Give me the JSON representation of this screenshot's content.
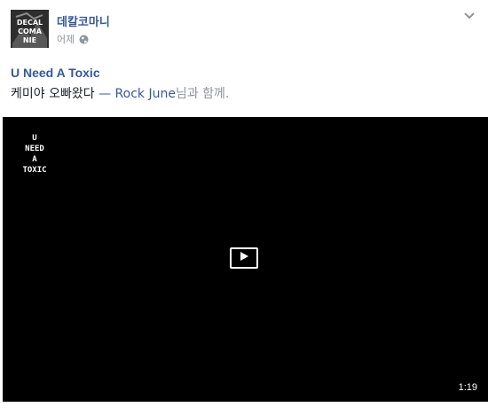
{
  "post": {
    "author": "데칼코마니",
    "timestamp": "어제",
    "privacy_icon": "globe-icon",
    "options_icon": "chevron-down-icon",
    "title": "U Need A Toxic",
    "caption": {
      "text": "케미야 오빠왔다",
      "separator": " — ",
      "tagged": "Rock June",
      "suffix": "님과 함께."
    },
    "avatar_text": "DECAL COMANIE",
    "video": {
      "overlay_lines": [
        "U",
        "NEED",
        "A",
        "TOXIC"
      ],
      "duration": "1:19",
      "play_icon": "play-icon"
    }
  },
  "colors": {
    "link": "#365899",
    "meta": "#90949c",
    "video_bg": "#000000"
  }
}
